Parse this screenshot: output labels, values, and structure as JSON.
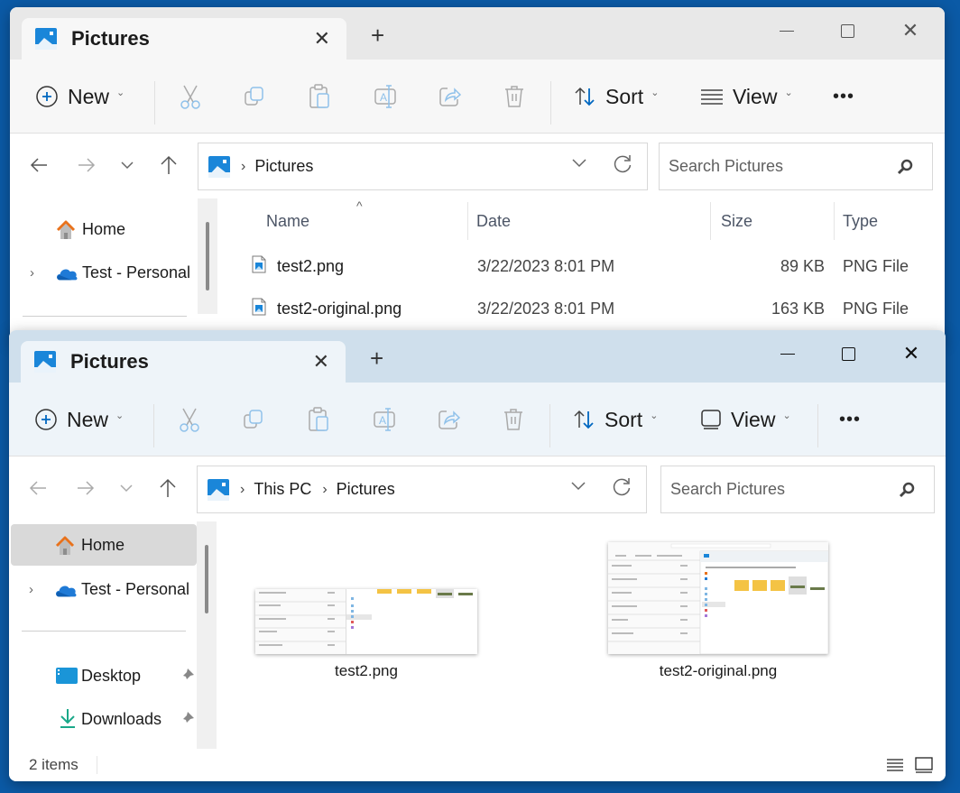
{
  "colors": {
    "desktop": "#0b5aa6",
    "accent": "#0067c0",
    "home_icon": "#e8721c",
    "onedrive": "#1f7ad6",
    "downloads": "#1aa889"
  },
  "window_back": {
    "tab_title": "Pictures",
    "new_tab_icon": "plus-icon",
    "controls": [
      "minimize",
      "maximize",
      "close"
    ],
    "toolbar": {
      "new_label": "New",
      "sort_label": "Sort",
      "view_label": "View",
      "view_icon": "details-view-icon",
      "more_label": "•••",
      "actions": [
        "cut",
        "copy",
        "paste",
        "rename",
        "share",
        "delete"
      ]
    },
    "breadcrumb": [
      "Pictures"
    ],
    "search_placeholder": "Search Pictures",
    "nav": [
      {
        "label": "Home",
        "icon": "home-icon"
      },
      {
        "label": "Test - Personal",
        "icon": "onedrive-cloud-icon",
        "expandable": true
      }
    ],
    "columns": {
      "name": "Name",
      "date": "Date",
      "size": "Size",
      "type": "Type"
    },
    "files": [
      {
        "name": "test2.png",
        "date": "3/22/2023 8:01 PM",
        "size": "89 KB",
        "type": "PNG File"
      },
      {
        "name": "test2-original.png",
        "date": "3/22/2023 8:01 PM",
        "size": "163 KB",
        "type": "PNG File"
      }
    ]
  },
  "window_front": {
    "tab_title": "Pictures",
    "controls": [
      "minimize",
      "maximize",
      "close"
    ],
    "toolbar": {
      "new_label": "New",
      "sort_label": "Sort",
      "view_label": "View",
      "view_icon": "large-icons-view-icon",
      "more_label": "•••"
    },
    "breadcrumb": [
      "This PC",
      "Pictures"
    ],
    "search_placeholder": "Search Pictures",
    "nav": [
      {
        "label": "Home",
        "icon": "home-icon",
        "selected": true
      },
      {
        "label": "Test - Personal",
        "icon": "onedrive-cloud-icon",
        "expandable": true
      },
      {
        "label": "Desktop",
        "icon": "desktop-icon",
        "pinned": true
      },
      {
        "label": "Downloads",
        "icon": "downloads-icon",
        "pinned": true
      }
    ],
    "files": [
      {
        "name": "test2.png"
      },
      {
        "name": "test2-original.png"
      }
    ],
    "status": {
      "item_count": "2 items"
    }
  }
}
